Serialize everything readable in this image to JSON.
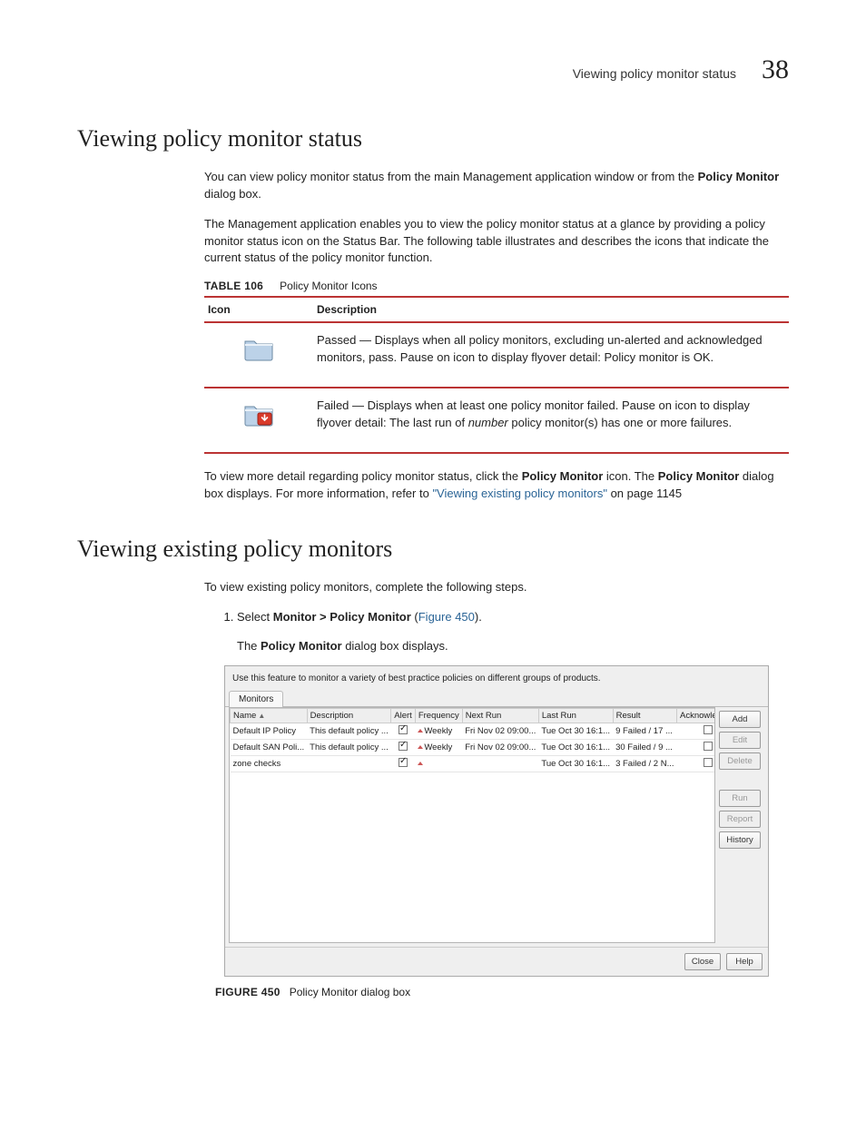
{
  "header": {
    "section_title": "Viewing policy monitor status",
    "page_number": "38"
  },
  "h1a": "Viewing policy monitor status",
  "p1": {
    "pre": "You can view policy monitor status from the main Management application window or from the ",
    "bold": "Policy Monitor",
    "post": " dialog box."
  },
  "p2": "The Management application enables you to view the policy monitor status at a glance by providing a policy monitor status icon on the Status Bar. The following table illustrates and describes the icons that indicate the current status of the policy monitor function.",
  "table106": {
    "caption_label": "TABLE 106",
    "caption_title": "Policy Monitor Icons",
    "head_icon": "Icon",
    "head_desc": "Description",
    "rows": [
      {
        "bold_lead": "Passed — Displays when all ",
        "mid": "policy monitors, excluding un-alerted and acknowledged monitors, pass. ",
        "tail": "Pause on icon to display flyover detail: Policy monitor is OK."
      },
      {
        "plain": "Failed — Displays when at least one policy monitor failed. Pause on icon to display flyover detail: The last run of ",
        "ital": "number",
        "tail2": " policy monitor(s) has one or more failures."
      }
    ]
  },
  "p3": {
    "a": "To view more detail regarding policy monitor status, click the ",
    "b": "Policy Monitor",
    "c": " icon. The ",
    "d": "Policy Monitor",
    "e": " dialog box displays. For more information, refer to ",
    "link": "\"Viewing existing policy monitors\"",
    "f": " on page 1145"
  },
  "h1b": "Viewing existing policy monitors",
  "p4": "To view existing policy monitors, complete the following steps.",
  "step1": {
    "a": "Select ",
    "b": "Monitor > Policy Monitor",
    "c": " (",
    "link": "Figure 450",
    "d": ")."
  },
  "sub1": {
    "a": "The ",
    "b": "Policy Monitor",
    "c": " dialog box displays."
  },
  "dialog": {
    "description": "Use this feature to monitor a variety of best practice policies on different groups of products.",
    "tab": "Monitors",
    "columns": [
      "Name",
      "Description",
      "Alert",
      "Frequency",
      "Next Run",
      "Last Run",
      "Result",
      "Acknowledged"
    ],
    "rows": [
      {
        "name": "Default IP Policy",
        "desc": "This default policy ...",
        "alert": true,
        "freq": "Weekly",
        "next": "Fri Nov 02 09:00...",
        "last": "Tue Oct 30 16:1...",
        "result": "9 Failed / 17 ...",
        "ack": false
      },
      {
        "name": "Default SAN Poli...",
        "desc": "This default policy ...",
        "alert": true,
        "freq": "Weekly",
        "next": "Fri Nov 02 09:00...",
        "last": "Tue Oct 30 16:1...",
        "result": "30 Failed / 9 ...",
        "ack": false
      },
      {
        "name": "zone checks",
        "desc": "",
        "alert": true,
        "freq": "",
        "next": "",
        "last": "Tue Oct 30 16:1...",
        "result": "3 Failed / 2 N...",
        "ack": false
      }
    ],
    "side_buttons": [
      {
        "label": "Add",
        "enabled": true
      },
      {
        "label": "Edit",
        "enabled": false
      },
      {
        "label": "Delete",
        "enabled": false
      },
      {
        "label": "Run",
        "enabled": false
      },
      {
        "label": "Report",
        "enabled": false
      },
      {
        "label": "History",
        "enabled": true
      }
    ],
    "footer_close": "Close",
    "footer_help": "Help"
  },
  "figure": {
    "label": "FIGURE 450",
    "title": "Policy Monitor dialog box"
  }
}
